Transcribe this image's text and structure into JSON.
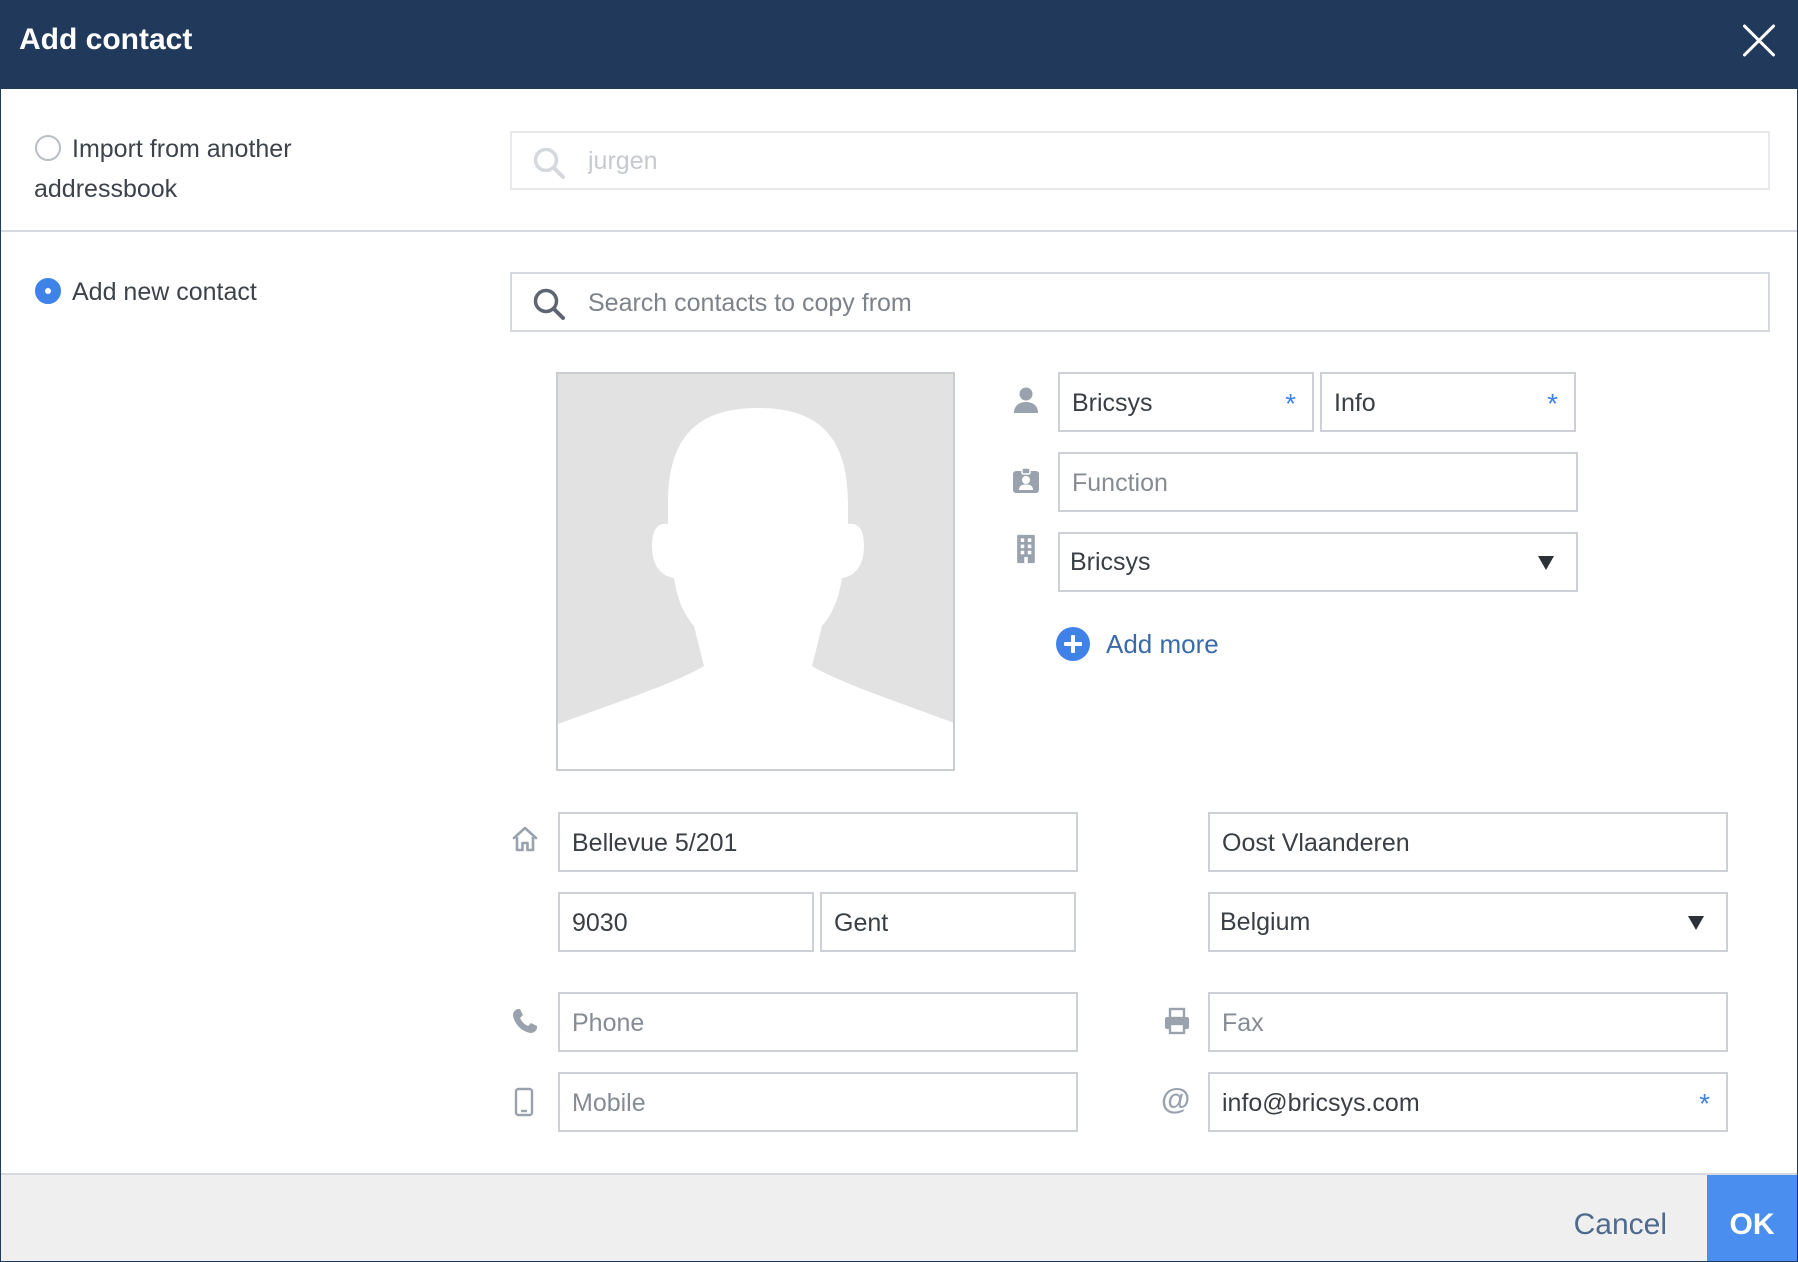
{
  "dialog": {
    "title": "Add contact"
  },
  "import_option": {
    "label_line1": "Import from another",
    "label_line2": "addressbook",
    "selected": false,
    "search_placeholder": "jurgen"
  },
  "new_option": {
    "label": "Add new contact",
    "selected": true,
    "search_placeholder": "Search contacts to copy from"
  },
  "contact": {
    "first_name": "Bricsys",
    "last_name": "Info",
    "function_placeholder": "Function",
    "company": "Bricsys",
    "add_more_label": "Add more"
  },
  "address": {
    "street": "Bellevue 5/201",
    "postal_code": "9030",
    "city": "Gent",
    "region": "Oost Vlaanderen",
    "country": "Belgium"
  },
  "communication": {
    "phone_placeholder": "Phone",
    "mobile_placeholder": "Mobile",
    "fax_placeholder": "Fax",
    "email": "info@bricsys.com"
  },
  "footer": {
    "cancel_label": "Cancel",
    "ok_label": "OK"
  },
  "colors": {
    "header_bg": "#213a5c",
    "accent": "#3f83e8",
    "ok_button": "#4a8ff0",
    "footer_bg": "#efefef"
  },
  "required_marker": "*"
}
